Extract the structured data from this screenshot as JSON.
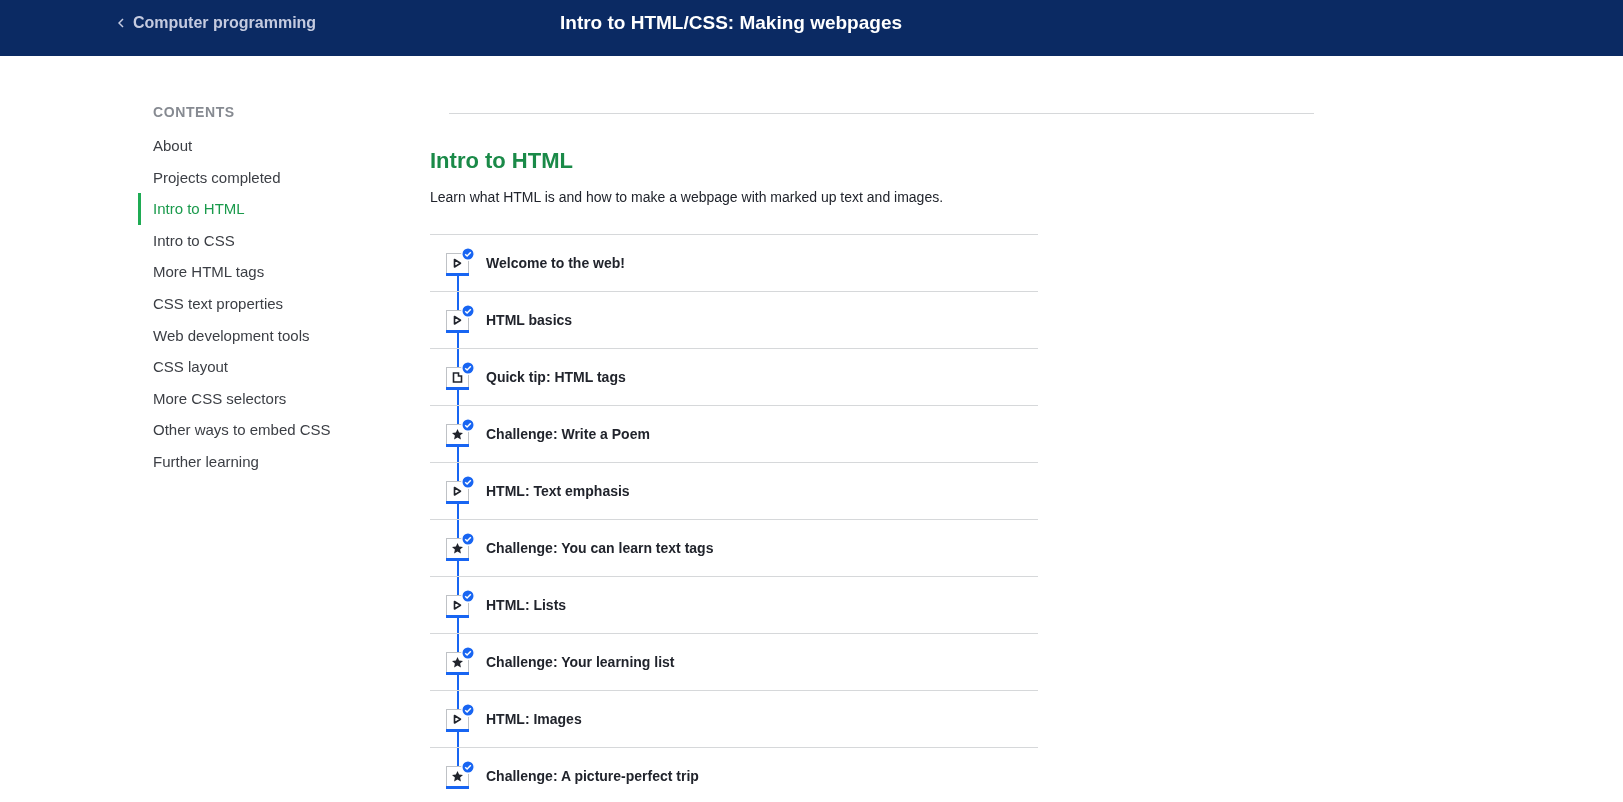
{
  "header": {
    "back_link": "Computer programming",
    "title": "Intro to HTML/CSS: Making webpages"
  },
  "sidebar": {
    "heading": "CONTENTS",
    "items": [
      {
        "label": "About",
        "selected": false
      },
      {
        "label": "Projects completed",
        "selected": false
      },
      {
        "label": "Intro to HTML",
        "selected": true
      },
      {
        "label": "Intro to CSS",
        "selected": false
      },
      {
        "label": "More HTML tags",
        "selected": false
      },
      {
        "label": "CSS text properties",
        "selected": false
      },
      {
        "label": "Web development tools",
        "selected": false
      },
      {
        "label": "CSS layout",
        "selected": false
      },
      {
        "label": "More CSS selectors",
        "selected": false
      },
      {
        "label": "Other ways to embed CSS",
        "selected": false
      },
      {
        "label": "Further learning",
        "selected": false
      }
    ]
  },
  "section": {
    "title": "Intro to HTML",
    "description": "Learn what HTML is and how to make a webpage with marked up text and images.",
    "lessons": [
      {
        "kind": "video",
        "title": "Welcome to the web!",
        "completed": true
      },
      {
        "kind": "video",
        "title": "HTML basics",
        "completed": true
      },
      {
        "kind": "article",
        "title": "Quick tip: HTML tags",
        "completed": true
      },
      {
        "kind": "challenge",
        "title": "Challenge: Write a Poem",
        "completed": true
      },
      {
        "kind": "video",
        "title": "HTML: Text emphasis",
        "completed": true
      },
      {
        "kind": "challenge",
        "title": "Challenge: You can learn text tags",
        "completed": true
      },
      {
        "kind": "video",
        "title": "HTML: Lists",
        "completed": true
      },
      {
        "kind": "challenge",
        "title": "Challenge: Your learning list",
        "completed": true
      },
      {
        "kind": "video",
        "title": "HTML: Images",
        "completed": true
      },
      {
        "kind": "challenge",
        "title": "Challenge: A picture-perfect trip",
        "completed": true
      }
    ]
  }
}
